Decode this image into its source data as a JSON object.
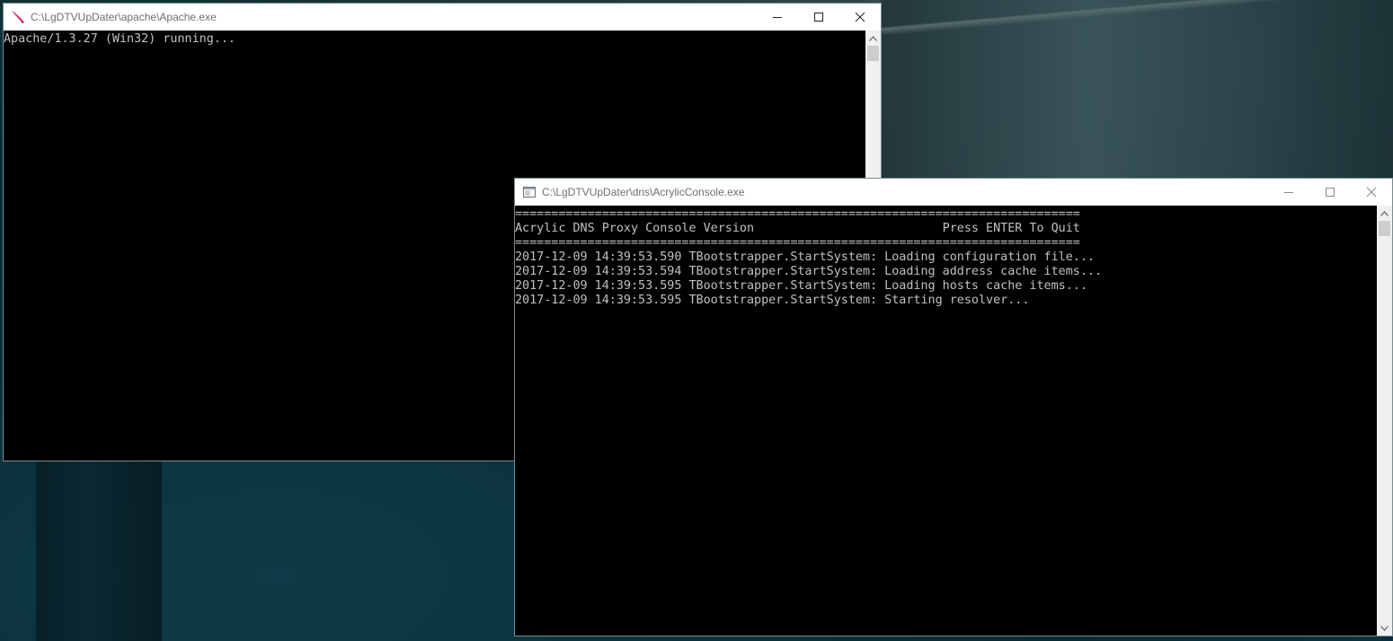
{
  "apache_window": {
    "title": "C:\\LgDTVUpDater\\apache\\Apache.exe",
    "icon": "apache-feather-icon",
    "console_lines": [
      "Apache/1.3.27 (Win32) running..."
    ]
  },
  "acrylic_window": {
    "title": "C:\\LgDTVUpDater\\dns\\AcrylicConsole.exe",
    "icon": "console-app-icon",
    "console_lines": [
      "==============================================================================",
      "Acrylic DNS Proxy Console Version                          Press ENTER To Quit",
      "==============================================================================",
      "2017-12-09 14:39:53.590 TBootstrapper.StartSystem: Loading configuration file...",
      "2017-12-09 14:39:53.594 TBootstrapper.StartSystem: Loading address cache items...",
      "2017-12-09 14:39:53.595 TBootstrapper.StartSystem: Loading hosts cache items...",
      "2017-12-09 14:39:53.595 TBootstrapper.StartSystem: Starting resolver..."
    ]
  },
  "colors": {
    "console_text": "#c0c0c0",
    "console_bg": "#000000",
    "titlebar_bg": "#ffffff",
    "title_text": "#6f6f6f"
  }
}
